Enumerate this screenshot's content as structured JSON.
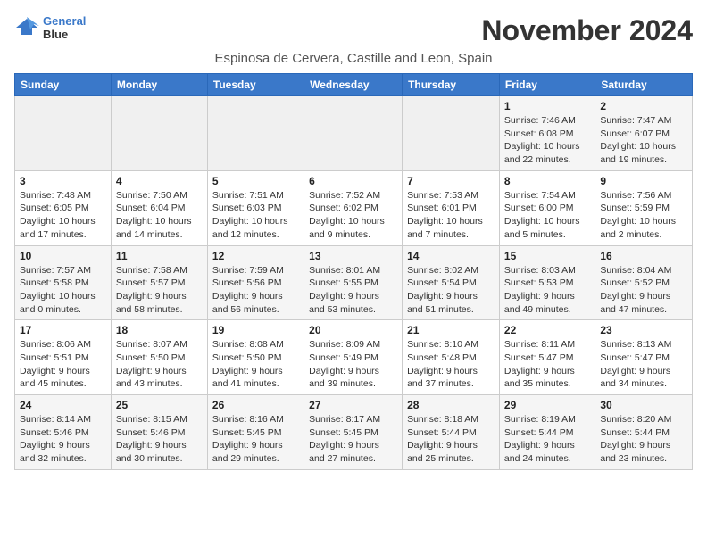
{
  "header": {
    "logo_line1": "General",
    "logo_line2": "Blue",
    "month_title": "November 2024",
    "location": "Espinosa de Cervera, Castille and Leon, Spain"
  },
  "weekdays": [
    "Sunday",
    "Monday",
    "Tuesday",
    "Wednesday",
    "Thursday",
    "Friday",
    "Saturday"
  ],
  "weeks": [
    [
      {
        "day": "",
        "info": ""
      },
      {
        "day": "",
        "info": ""
      },
      {
        "day": "",
        "info": ""
      },
      {
        "day": "",
        "info": ""
      },
      {
        "day": "",
        "info": ""
      },
      {
        "day": "1",
        "info": "Sunrise: 7:46 AM\nSunset: 6:08 PM\nDaylight: 10 hours and 22 minutes."
      },
      {
        "day": "2",
        "info": "Sunrise: 7:47 AM\nSunset: 6:07 PM\nDaylight: 10 hours and 19 minutes."
      }
    ],
    [
      {
        "day": "3",
        "info": "Sunrise: 7:48 AM\nSunset: 6:05 PM\nDaylight: 10 hours and 17 minutes."
      },
      {
        "day": "4",
        "info": "Sunrise: 7:50 AM\nSunset: 6:04 PM\nDaylight: 10 hours and 14 minutes."
      },
      {
        "day": "5",
        "info": "Sunrise: 7:51 AM\nSunset: 6:03 PM\nDaylight: 10 hours and 12 minutes."
      },
      {
        "day": "6",
        "info": "Sunrise: 7:52 AM\nSunset: 6:02 PM\nDaylight: 10 hours and 9 minutes."
      },
      {
        "day": "7",
        "info": "Sunrise: 7:53 AM\nSunset: 6:01 PM\nDaylight: 10 hours and 7 minutes."
      },
      {
        "day": "8",
        "info": "Sunrise: 7:54 AM\nSunset: 6:00 PM\nDaylight: 10 hours and 5 minutes."
      },
      {
        "day": "9",
        "info": "Sunrise: 7:56 AM\nSunset: 5:59 PM\nDaylight: 10 hours and 2 minutes."
      }
    ],
    [
      {
        "day": "10",
        "info": "Sunrise: 7:57 AM\nSunset: 5:58 PM\nDaylight: 10 hours and 0 minutes."
      },
      {
        "day": "11",
        "info": "Sunrise: 7:58 AM\nSunset: 5:57 PM\nDaylight: 9 hours and 58 minutes."
      },
      {
        "day": "12",
        "info": "Sunrise: 7:59 AM\nSunset: 5:56 PM\nDaylight: 9 hours and 56 minutes."
      },
      {
        "day": "13",
        "info": "Sunrise: 8:01 AM\nSunset: 5:55 PM\nDaylight: 9 hours and 53 minutes."
      },
      {
        "day": "14",
        "info": "Sunrise: 8:02 AM\nSunset: 5:54 PM\nDaylight: 9 hours and 51 minutes."
      },
      {
        "day": "15",
        "info": "Sunrise: 8:03 AM\nSunset: 5:53 PM\nDaylight: 9 hours and 49 minutes."
      },
      {
        "day": "16",
        "info": "Sunrise: 8:04 AM\nSunset: 5:52 PM\nDaylight: 9 hours and 47 minutes."
      }
    ],
    [
      {
        "day": "17",
        "info": "Sunrise: 8:06 AM\nSunset: 5:51 PM\nDaylight: 9 hours and 45 minutes."
      },
      {
        "day": "18",
        "info": "Sunrise: 8:07 AM\nSunset: 5:50 PM\nDaylight: 9 hours and 43 minutes."
      },
      {
        "day": "19",
        "info": "Sunrise: 8:08 AM\nSunset: 5:50 PM\nDaylight: 9 hours and 41 minutes."
      },
      {
        "day": "20",
        "info": "Sunrise: 8:09 AM\nSunset: 5:49 PM\nDaylight: 9 hours and 39 minutes."
      },
      {
        "day": "21",
        "info": "Sunrise: 8:10 AM\nSunset: 5:48 PM\nDaylight: 9 hours and 37 minutes."
      },
      {
        "day": "22",
        "info": "Sunrise: 8:11 AM\nSunset: 5:47 PM\nDaylight: 9 hours and 35 minutes."
      },
      {
        "day": "23",
        "info": "Sunrise: 8:13 AM\nSunset: 5:47 PM\nDaylight: 9 hours and 34 minutes."
      }
    ],
    [
      {
        "day": "24",
        "info": "Sunrise: 8:14 AM\nSunset: 5:46 PM\nDaylight: 9 hours and 32 minutes."
      },
      {
        "day": "25",
        "info": "Sunrise: 8:15 AM\nSunset: 5:46 PM\nDaylight: 9 hours and 30 minutes."
      },
      {
        "day": "26",
        "info": "Sunrise: 8:16 AM\nSunset: 5:45 PM\nDaylight: 9 hours and 29 minutes."
      },
      {
        "day": "27",
        "info": "Sunrise: 8:17 AM\nSunset: 5:45 PM\nDaylight: 9 hours and 27 minutes."
      },
      {
        "day": "28",
        "info": "Sunrise: 8:18 AM\nSunset: 5:44 PM\nDaylight: 9 hours and 25 minutes."
      },
      {
        "day": "29",
        "info": "Sunrise: 8:19 AM\nSunset: 5:44 PM\nDaylight: 9 hours and 24 minutes."
      },
      {
        "day": "30",
        "info": "Sunrise: 8:20 AM\nSunset: 5:44 PM\nDaylight: 9 hours and 23 minutes."
      }
    ]
  ]
}
